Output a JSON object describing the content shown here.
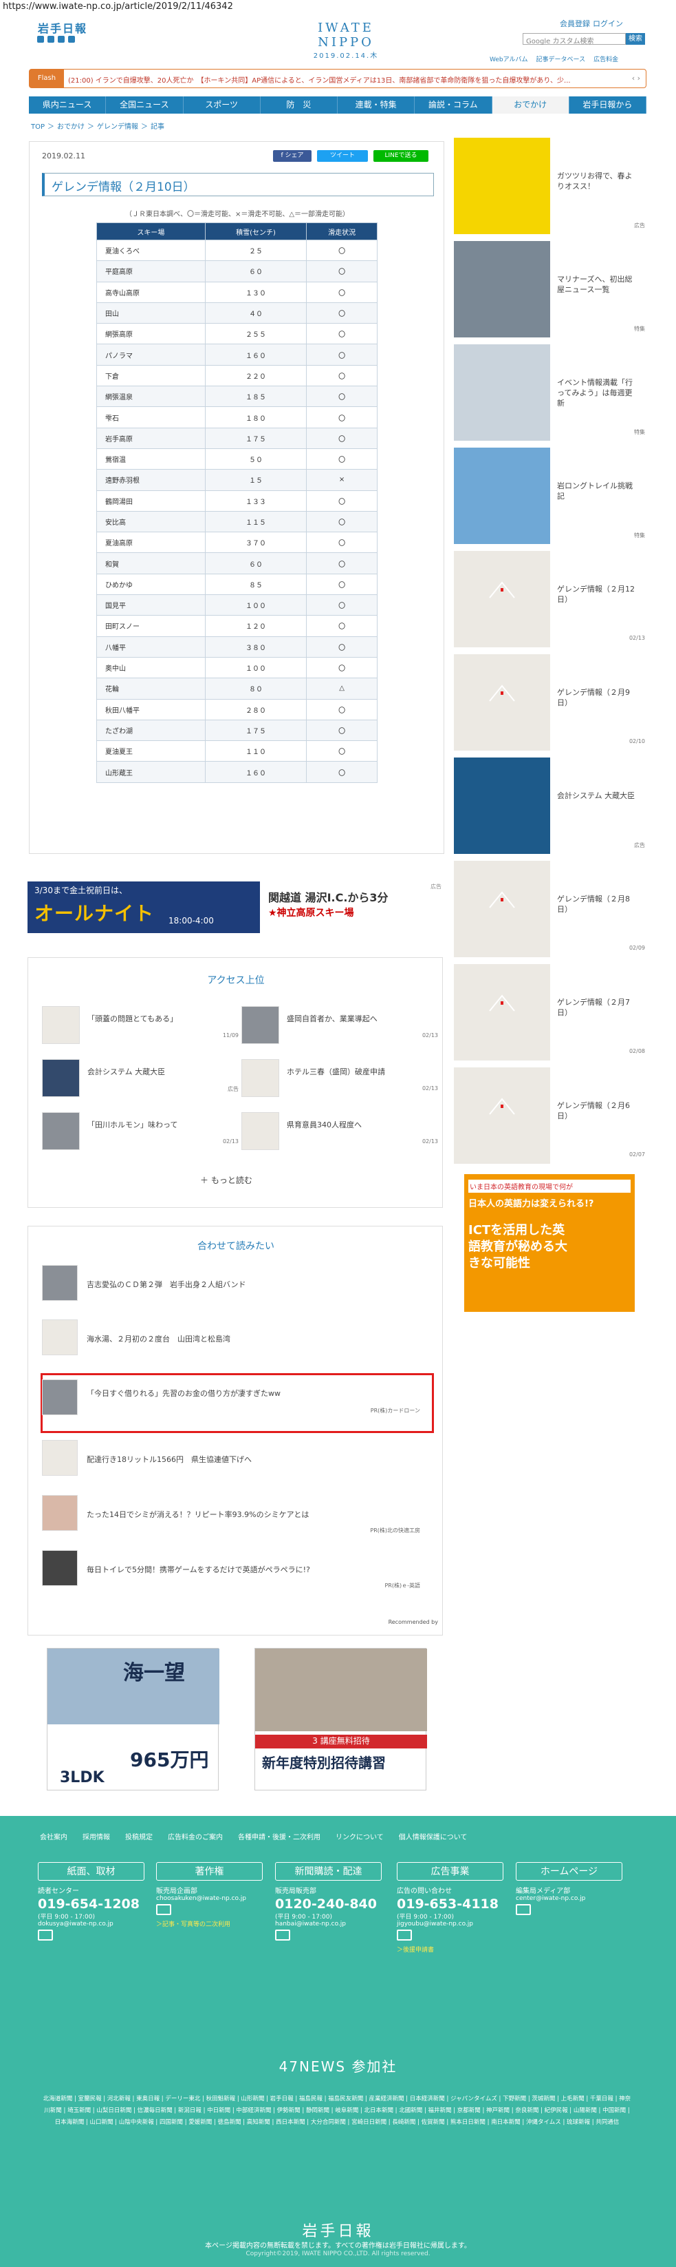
{
  "url": "https://www.iwate-np.co.jp/article/2019/2/11/46342",
  "header": {
    "logo_small": "岩手日報",
    "logo_main": "IWATE NIPPO",
    "date": "2019.02.14.木",
    "member": "会員登録",
    "login": "ログイン",
    "search_placeholder": "Google カスタム検索",
    "search_btn": "検索",
    "links": [
      "Webアルバム",
      "記事データベース",
      "広告料金"
    ]
  },
  "ticker": {
    "label": "Flash",
    "text": "(21:00) イランで自爆攻撃、20人死亡か　【ホーキン共同】AP通信によると、イラン国営メディアは13日、南部諸省部で革命防衛隊を狙った自爆攻撃があり、少..."
  },
  "nav": [
    "県内ニュース",
    "全国ニュース",
    "スポーツ",
    "防　災",
    "連載・特集",
    "論説・コラム",
    "おでかけ",
    "岩手日報から"
  ],
  "breadcrumb": [
    "TOP",
    "＞",
    "おでかけ",
    "＞",
    "ゲレンデ情報",
    "＞",
    "記事"
  ],
  "article": {
    "date": "2019.02.11",
    "share_fb": "f シェア",
    "share_tw": "ツイート",
    "share_line": "LINEで送る",
    "title": "ゲレンデ情報（２月10日）",
    "note": "（ＪＲ東日本調べ、〇＝滑走可能、×＝滑走不可能、△＝一部滑走可能）",
    "headers": [
      "スキー場",
      "積雪(センチ)",
      "滑走状況"
    ],
    "rows": [
      [
        "夏油くろべ",
        "２５",
        "〇"
      ],
      [
        "平庭高原",
        "６０",
        "〇"
      ],
      [
        "高寺山高原",
        "１３０",
        "〇"
      ],
      [
        "田山",
        "４０",
        "〇"
      ],
      [
        "網張高原",
        "２５５",
        "〇"
      ],
      [
        "パノラマ",
        "１６０",
        "〇"
      ],
      [
        "下倉",
        "２２０",
        "〇"
      ],
      [
        "網張温泉",
        "１８５",
        "〇"
      ],
      [
        "雫石",
        "１８０",
        "〇"
      ],
      [
        "岩手高原",
        "１７５",
        "〇"
      ],
      [
        "鶯宿温",
        "５０",
        "〇"
      ],
      [
        "遠野赤羽根",
        "１５",
        "×"
      ],
      [
        "鶴岡湯田",
        "１３３",
        "〇"
      ],
      [
        "安比高",
        "１１５",
        "〇"
      ],
      [
        "夏油高原",
        "３７０",
        "〇"
      ],
      [
        "和賀",
        "６０",
        "〇"
      ],
      [
        "ひめかゆ",
        "８５",
        "〇"
      ],
      [
        "国見平",
        "１００",
        "〇"
      ],
      [
        "田町スノー",
        "１２０",
        "〇"
      ],
      [
        "八幡平",
        "３８０",
        "〇"
      ],
      [
        "奥中山",
        "１００",
        "〇"
      ],
      [
        "花輪",
        "８０",
        "△"
      ],
      [
        "秋田八幡平",
        "２８０",
        "〇"
      ],
      [
        "たざわ湖",
        "１７５",
        "〇"
      ],
      [
        "夏油夏王",
        "１１０",
        "〇"
      ],
      [
        "山形蔵王",
        "１６０",
        "〇"
      ]
    ]
  },
  "ad1": {
    "line1": "3/30まで金土祝前日は、",
    "line2": "オールナイト",
    "time": "18:00-4:00",
    "right1": "関越道 湯沢I.C.から3分",
    "right2": "★神立高原スキー場",
    "tag": "広告"
  },
  "access": {
    "heading": "アクセス上位",
    "items": [
      {
        "text": "「頭蓋の問題とてもある」",
        "date": "11/09"
      },
      {
        "text": "盛岡自首者か、業業導起へ",
        "date": "02/13"
      },
      {
        "text": "会計システム 大蔵大臣",
        "date": "広告"
      },
      {
        "text": "ホテル三春（盛岡）破産申請",
        "date": "02/13"
      },
      {
        "text": "「田川ホルモン」味わって",
        "date": "02/13"
      },
      {
        "text": "県育意員340人程度へ",
        "date": "02/13"
      }
    ],
    "more": "＋ もっと読む"
  },
  "also": {
    "heading": "合わせて読みたい",
    "items": [
      {
        "text": "吉志愛弘のＣＤ第２弾　岩手出身２人組バンド",
        "pr": ""
      },
      {
        "text": "海水湯、２月初の２度台　山田湾と松島湾",
        "pr": ""
      },
      {
        "text": "「今日すぐ借りれる」先習のお金の借り方が凄すぎたww",
        "pr": "PR(株)カードローン"
      },
      {
        "text": "配達行き18リットル1566円　県生協連値下げへ",
        "pr": ""
      },
      {
        "text": "たった14日でシミが消える！？リピート率93.9%のシミケアとは",
        "pr": "PR(株)北の快適工房"
      },
      {
        "text": "毎日トイレで5分間！携帯ゲームをするだけで英語がペラペラに!?",
        "pr": "PR(株)ｅ-英語"
      }
    ],
    "recommended": "Recommended by"
  },
  "ads_bottom": {
    "left_brand": "海一望",
    "left_price": "965万円",
    "left_sub": "3LDK",
    "right_title": "新年度特別招待講習",
    "right_sub": "3 講座無料招待"
  },
  "sidebar": [
    {
      "text": "ガツツリお得で、春よりオスス！",
      "date": "広告"
    },
    {
      "text": "マリナーズへ、初出総屋ニュース一覧",
      "date": "特集"
    },
    {
      "text": "イベント情報満載「行ってみよう」は毎週更新",
      "date": "特集"
    },
    {
      "text": "岩ロングトレイル挑戦記",
      "date": "特集"
    },
    {
      "text": "ゲレンデ情報（２月12日）",
      "date": "02/13"
    },
    {
      "text": "ゲレンデ情報（２月9日）",
      "date": "02/10"
    },
    {
      "text": "会計システム 大蔵大臣",
      "date": "広告"
    },
    {
      "text": "ゲレンデ情報（２月8日）",
      "date": "02/09"
    },
    {
      "text": "ゲレンデ情報（２月7日）",
      "date": "02/08"
    },
    {
      "text": "ゲレンデ情報（２月6日）",
      "date": "02/07"
    }
  ],
  "side_ad": {
    "line1": "いま日本の英語教育の現場で何が",
    "line2": "日本人の英語力は変えられる!?",
    "line3": "ICTを活用した英語教育が秘める大きな可能性"
  },
  "footer": {
    "links": [
      "会社案内",
      "採用情報",
      "投稿規定",
      "広告料金のご案内",
      "各種申請・後援・二次利用",
      "リンクについて",
      "個人情報保護について"
    ],
    "cols": [
      {
        "head": "紙面、取材",
        "s1": "読者センター",
        "ph": "019-654-1208",
        "s2": "(平日 9:00 - 17:00)",
        "ml": "dokusya@iwate-np.co.jp",
        "lk": ""
      },
      {
        "head": "著作権",
        "s1": "販売局企画部",
        "ph": "",
        "s2": "",
        "ml": "choosakuken@iwate-np.co.jp",
        "lk": "＞記事・写真等の二次利用"
      },
      {
        "head": "新聞購読・配達",
        "s1": "販売局販売部",
        "ph": "0120-240-840",
        "s2": "(平日 9:00 - 17:00)",
        "ml": "hanbai@iwate-np.co.jp",
        "lk": ""
      },
      {
        "head": "広告事業",
        "s1": "広告の問い合わせ",
        "ph": "019-653-4118",
        "s2": "(平日 9:00 - 17:00)",
        "ml": "jigyoubu@iwate-np.co.jp",
        "lk": "＞後援申請書"
      },
      {
        "head": "ホームページ",
        "s1": "編集局メディア部",
        "ph": "",
        "s2": "",
        "ml": "center@iwate-np.co.jp",
        "lk": ""
      }
    ],
    "n47": "47NEWS 参加社",
    "n47list": "北海道新聞 | 室蘭民報 | 河北新報 | 東奥日報 | デーリー東北 | 秋田魁新報 | 山形新聞 | 岩手日報 | 福島民報 | 福島民友新聞 | 産業経済新聞 | 日本経済新聞 | ジャパンタイムズ | 下野新聞 | 茨城新聞 | 上毛新聞 | 千葉日報 | 神奈川新聞 | 埼玉新聞 | 山梨日日新聞 | 信濃毎日新聞 | 新潟日報 | 中日新聞 | 中部経済新聞 | 伊勢新聞 | 静岡新聞 | 岐阜新聞 | 北日本新聞 | 北國新聞 | 福井新聞 | 京都新聞 | 神戸新聞 | 奈良新聞 | 紀伊民報 | 山陽新聞 | 中国新聞 | 日本海新聞 | 山口新聞 | 山陰中央新報 | 四国新聞 | 愛媛新聞 | 徳島新聞 | 高知新聞 | 西日本新聞 | 大分合同新聞 | 宮崎日日新聞 | 長崎新聞 | 佐賀新聞 | 熊本日日新聞 | 南日本新聞 | 沖縄タイムス | 琉球新報 | 共同通信",
    "logo": "岩手日報",
    "copy": "本ページ掲載内容の無断転載を禁じます。すべての著作権は岩手日報社に帰属します。",
    "copy2": "Copyright©2019, IWATE NIPPO CO.,LTD. All rights reserved."
  }
}
